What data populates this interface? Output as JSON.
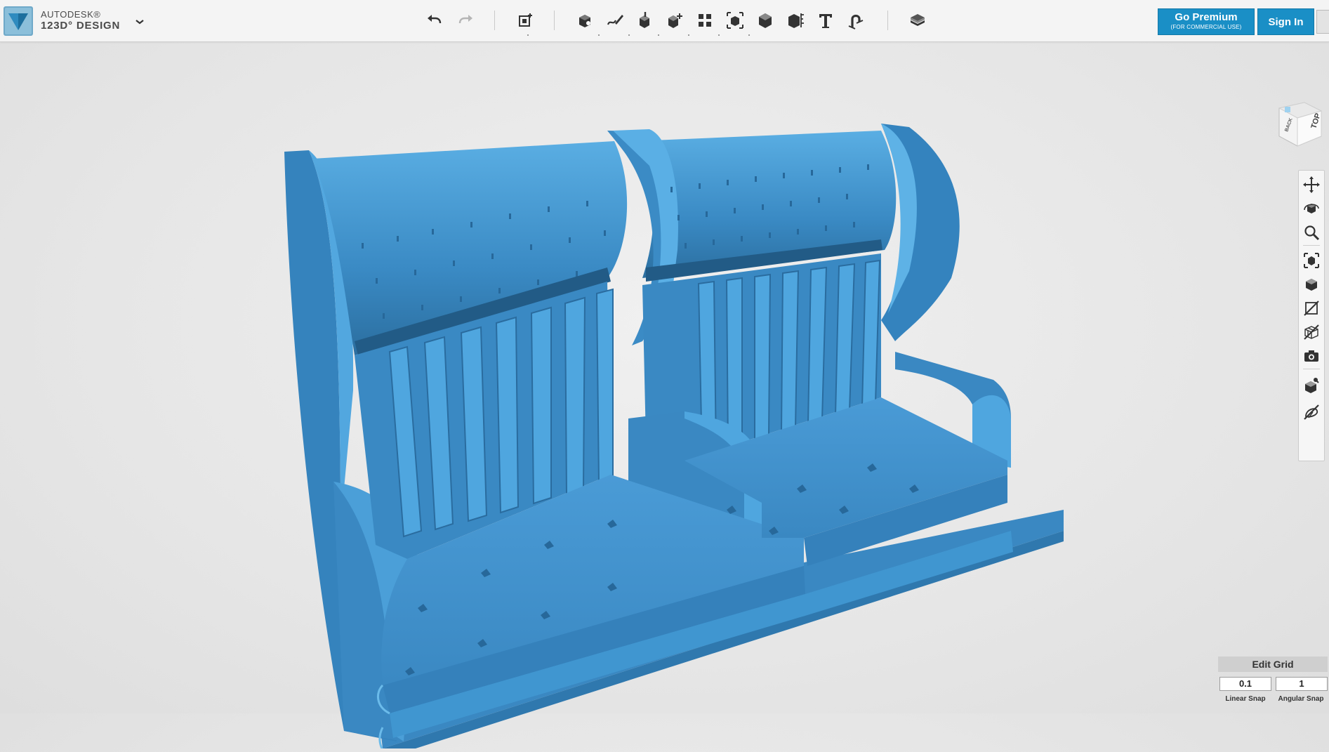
{
  "app": {
    "brand_line1": "AUTODESK®",
    "brand_line2": "123D° DESIGN"
  },
  "toolbar": {
    "tools": [
      "undo-icon",
      "redo-icon",
      "add-box-icon",
      "primitives-icon",
      "sketch-icon",
      "construct-icon",
      "modify-icon",
      "pattern-icon",
      "grouping-icon",
      "combine-icon",
      "measure-icon",
      "text-icon",
      "snap-icon",
      "material-icon"
    ]
  },
  "account": {
    "premium_label": "Go Premium",
    "premium_sub": "(FOR COMMERCIAL USE)",
    "signin_label": "Sign In"
  },
  "viewcube": {
    "top_label": "TOP",
    "back_label": "BACK"
  },
  "nav": {
    "items": [
      "pan-icon",
      "orbit-icon",
      "zoom-icon",
      "fit-icon",
      "views-icon",
      "hide-sketch-icon",
      "hide-mesh-icon",
      "camera-icon",
      "material-toggle-icon",
      "outline-toggle-icon"
    ]
  },
  "grid": {
    "title": "Edit Grid",
    "linear_value": "0.1",
    "linear_label": "Linear Snap",
    "angular_value": "1",
    "angular_label": "Angular Snap"
  },
  "colors": {
    "accent": "#1a8fc6",
    "model": "#3b8fcc"
  }
}
